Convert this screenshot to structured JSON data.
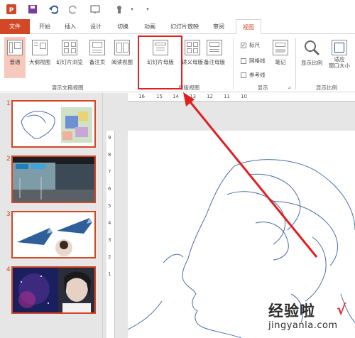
{
  "tabs": {
    "file": "文件",
    "items": [
      "开始",
      "插入",
      "设计",
      "切换",
      "动画",
      "幻灯片放映",
      "审阅",
      "视图"
    ],
    "active": "视图"
  },
  "ribbon": {
    "presentation_views": [
      "普通",
      "大纲视图",
      "幻灯片浏览",
      "备注页",
      "阅读视图"
    ],
    "presentation_views_label": "演示文稿视图",
    "master_views": [
      "幻灯片母版",
      "讲义母版",
      "备注母版"
    ],
    "master_views_label": "母版视图",
    "show": {
      "ruler": "标尺",
      "gridlines": "网格线",
      "guides": "参考线",
      "notes": "笔记",
      "label": "显示",
      "ruler_checked": true
    },
    "zoom": {
      "zoom_btn": "显示比例",
      "fit_btn": "适应\n窗口大小",
      "label": "显示比例"
    }
  },
  "thumbnails": [
    "1",
    "2",
    "3",
    "4"
  ],
  "ruler": {
    "h_ticks": [
      "16",
      "15",
      "14",
      "13",
      "12",
      "11",
      "10"
    ],
    "v_ticks": [
      "9",
      "8",
      "7",
      "6",
      "5",
      "4",
      "3",
      "2",
      "1"
    ]
  },
  "watermark": {
    "line1": "经验啦",
    "line2": "jingyanla.com",
    "check": "√"
  },
  "colors": {
    "accent": "#d24726",
    "highlight": "#e02020",
    "outline": "#4a6ea8"
  }
}
